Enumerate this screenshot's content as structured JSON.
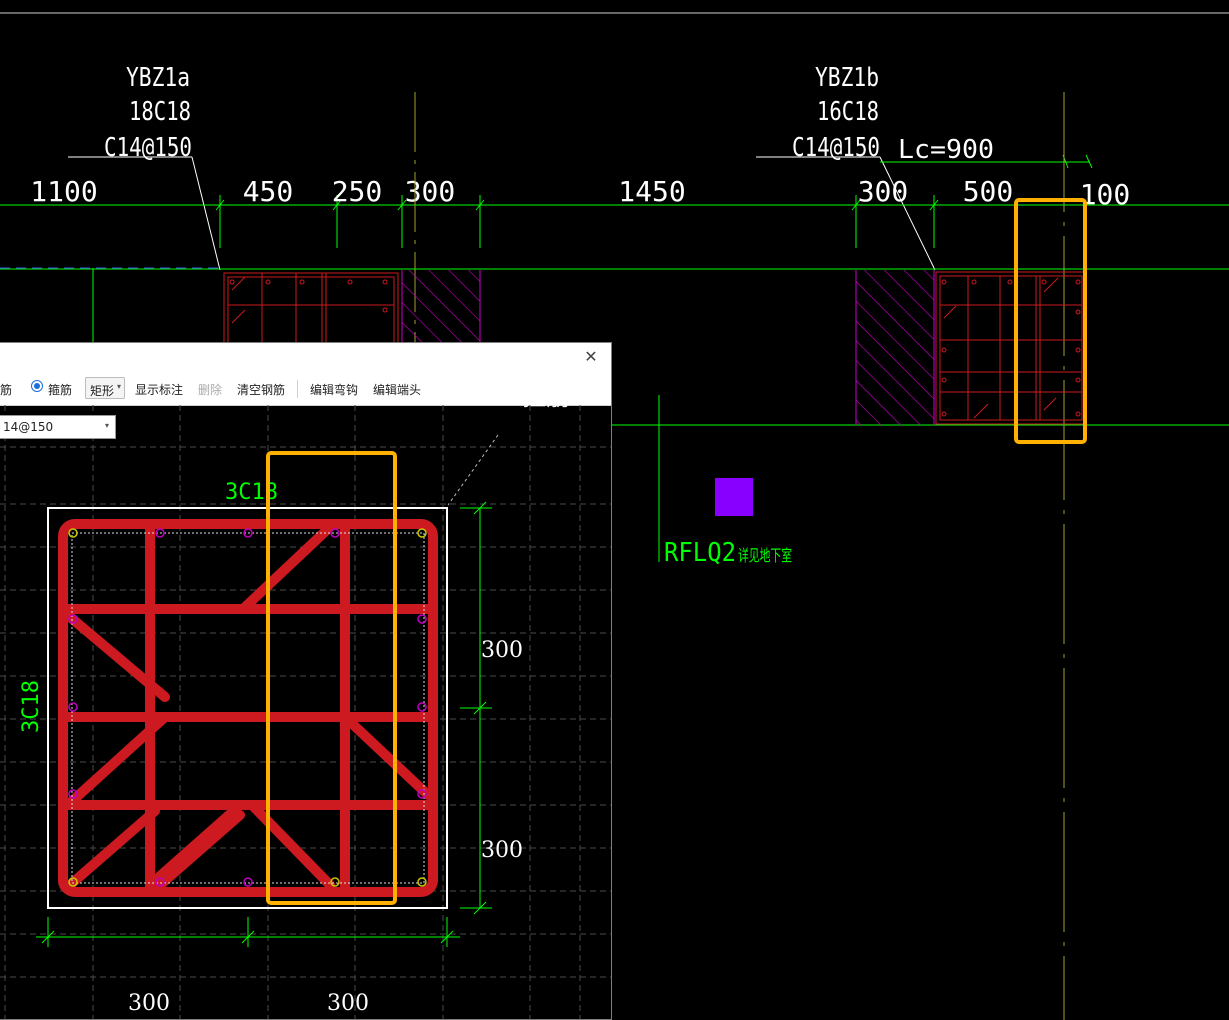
{
  "cad": {
    "col_left": {
      "name": "YBZ1a",
      "rebar": "18C18",
      "stirrup": "C14@150"
    },
    "col_right": {
      "name": "YBZ1b",
      "rebar": "16C18",
      "stirrup": "C14@150",
      "lc": "Lc=900"
    },
    "dims": [
      "1100",
      "450",
      "250",
      "300",
      "1450",
      "300",
      "500",
      "100"
    ],
    "wall_label": "RFLQ2",
    "wall_note": "详见地下室"
  },
  "dialog": {
    "close_glyph": "✕",
    "toolbar": {
      "partial_label": "筋",
      "stirrup_radio": "箍筋",
      "shape_select": "矩形",
      "show_dims": "显示标注",
      "delete": "删除",
      "clear_rebar": "清空钢筋",
      "edit_hook": "编辑弯钩",
      "edit_end": "编辑端头"
    },
    "stirrup_combo": "14@150",
    "bg_label": "拉筋",
    "section": {
      "top_rebar": "3C18",
      "left_rebar": "3C18",
      "dim_right_top": "300",
      "dim_right_bottom": "300",
      "dim_bottom_left": "300",
      "dim_bottom_right": "300"
    }
  },
  "colors": {
    "dim_green": "#00ff00",
    "rebar_red": "#cc1a20",
    "hatch_magenta": "#cc00cc",
    "highlight_orange": "#ffb000",
    "marker_purple": "#8800ff"
  },
  "icons": [
    "radio-checked-icon",
    "chevron-down-icon",
    "close-icon"
  ]
}
